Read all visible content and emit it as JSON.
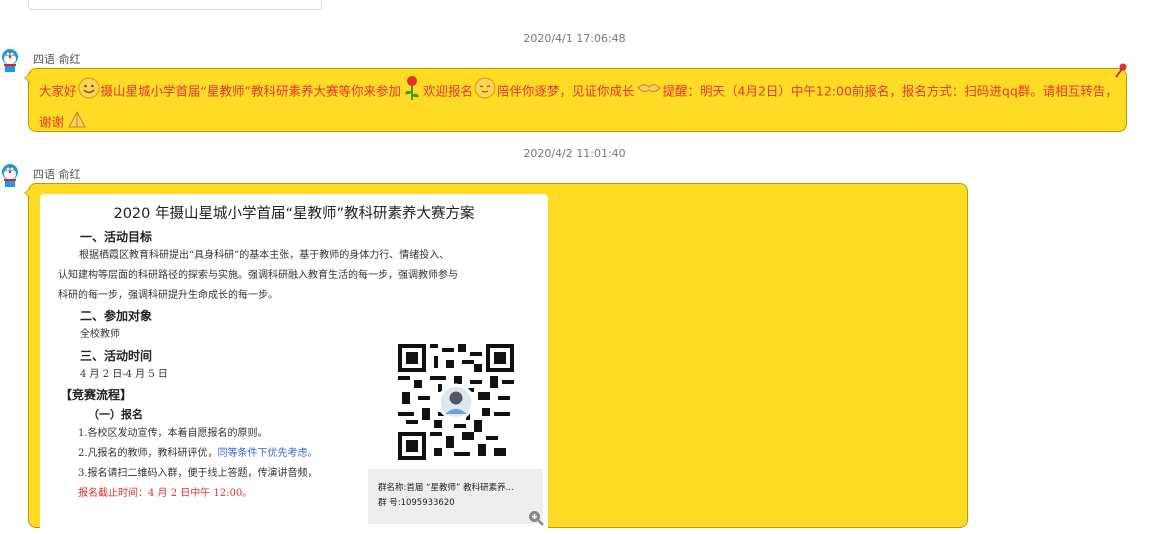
{
  "messages": [
    {
      "timestamp": "2020/4/1 17:06:48",
      "sender": "四语 俞红",
      "text_parts": {
        "p1": "大家好",
        "p2": "摄山星城小学首届“星教师”教科研素养大赛等你来参加",
        "p3": "欢迎报名",
        "p4": "陪伴你逐梦，见证你成长",
        "p5": "提醒：明天（4月2日）中午12:00前报名，报名方式：扫码进qq群。请相互转告，谢谢"
      },
      "emojis": [
        "smile-icon",
        "rose-icon",
        "welcome-icon",
        "handshake-icon",
        "pray-icon"
      ]
    },
    {
      "timestamp": "2020/4/2 11:01:40",
      "sender": "四语 俞红",
      "doc": {
        "title": "2020 年摄山星城小学首届“星教师”教科研素养大赛方案",
        "s1_heading": "一、活动目标",
        "s1_line1": "根据栖霞区教育科研提出“具身科研”的基本主张，基于教师的身体力行、情绪投入、",
        "s1_line2": "认知建构等层面的科研路径的探索与实施。强调科研融入教育生活的每一步，强调教师参与",
        "s1_line3": "科研的每一步，强调科研提升生命成长的每一步。",
        "s2_heading": "二、参加对象",
        "s2_text": "全校教师",
        "s3_heading": "三、活动时间",
        "s3_text": "4 月 2 日-4 月 5 日",
        "s4_heading": "【竞赛流程】",
        "s4_sub": "（一）报名",
        "item1": "1.各校区发动宣传，本着自愿报名的原则。",
        "item2_a": "2.凡报名的教师，教科研评优，",
        "item2_b": "同等条件下优先考虑。",
        "item3": "3.报名请扫二维码入群，便于线上答题，传演讲音频，",
        "deadline": "报名截止时间：4 月 2 日中午 12:00。",
        "qr_group_name": "群名称:首届 “星教师” 教科研素养...",
        "qr_group_number": "群   号:1095933620"
      }
    }
  ],
  "colors": {
    "bubble": "#fedc26",
    "bubble_border": "#b79a00",
    "message_text": "#e53333"
  }
}
